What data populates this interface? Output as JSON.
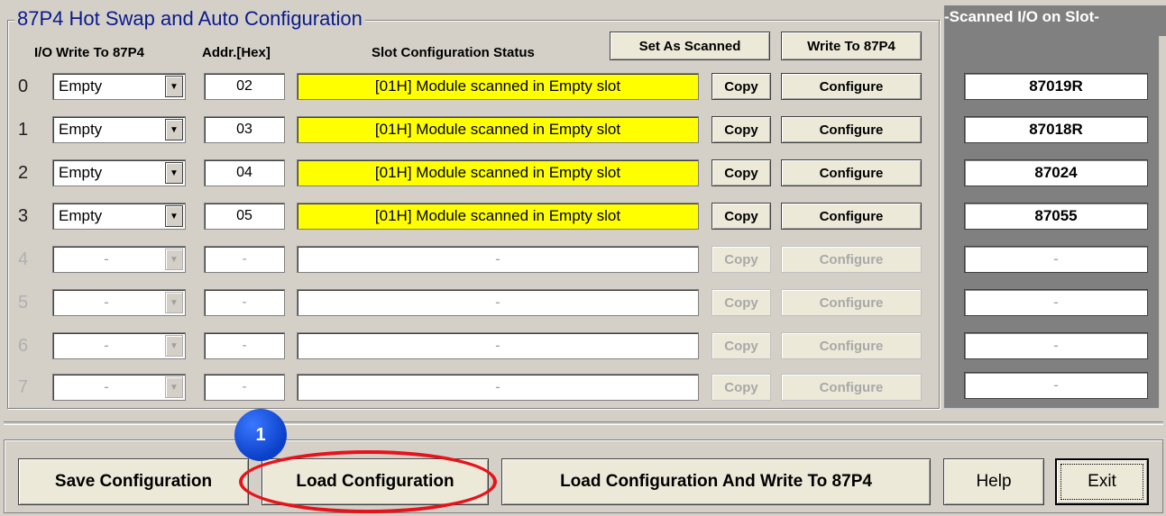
{
  "window": {
    "title": "87P4 Hot Swap and Auto Configuration"
  },
  "columns": {
    "io_write": "I/O Write To 87P4",
    "addr": "Addr.[Hex]",
    "status": "Slot Configuration Status"
  },
  "top_buttons": {
    "set_as_scanned": "Set As Scanned",
    "write_to_87p4": "Write To 87P4"
  },
  "slots": [
    {
      "num": "0",
      "io": "Empty",
      "addr": "02",
      "status": "[01H] Module scanned in Empty slot",
      "copy": "Copy",
      "configure": "Configure",
      "scanned": "87019R",
      "enabled": true
    },
    {
      "num": "1",
      "io": "Empty",
      "addr": "03",
      "status": "[01H] Module scanned in Empty slot",
      "copy": "Copy",
      "configure": "Configure",
      "scanned": "87018R",
      "enabled": true
    },
    {
      "num": "2",
      "io": "Empty",
      "addr": "04",
      "status": "[01H] Module scanned in Empty slot",
      "copy": "Copy",
      "configure": "Configure",
      "scanned": "87024",
      "enabled": true
    },
    {
      "num": "3",
      "io": "Empty",
      "addr": "05",
      "status": "[01H] Module scanned in Empty slot",
      "copy": "Copy",
      "configure": "Configure",
      "scanned": "87055",
      "enabled": true
    },
    {
      "num": "4",
      "io": "-",
      "addr": "-",
      "status": "-",
      "copy": "Copy",
      "configure": "Configure",
      "scanned": "-",
      "enabled": false
    },
    {
      "num": "5",
      "io": "-",
      "addr": "-",
      "status": "-",
      "copy": "Copy",
      "configure": "Configure",
      "scanned": "-",
      "enabled": false
    },
    {
      "num": "6",
      "io": "-",
      "addr": "-",
      "status": "-",
      "copy": "Copy",
      "configure": "Configure",
      "scanned": "-",
      "enabled": false
    },
    {
      "num": "7",
      "io": "-",
      "addr": "-",
      "status": "-",
      "copy": "Copy",
      "configure": "Configure",
      "scanned": "-",
      "enabled": false
    }
  ],
  "scan_panel": {
    "title": "Scanned I/O on Slot"
  },
  "bottom_buttons": {
    "save": "Save Configuration",
    "load": "Load Configuration",
    "load_write": "Load  Configuration And Write To 87P4",
    "help": "Help",
    "exit": "Exit"
  },
  "annotation": {
    "step": "1"
  },
  "colors": {
    "status_yellow": "#ffff00",
    "title_blue": "#0a1a8c",
    "highlight_red": "#e8121a",
    "badge_blue": "#0a3fc8"
  }
}
